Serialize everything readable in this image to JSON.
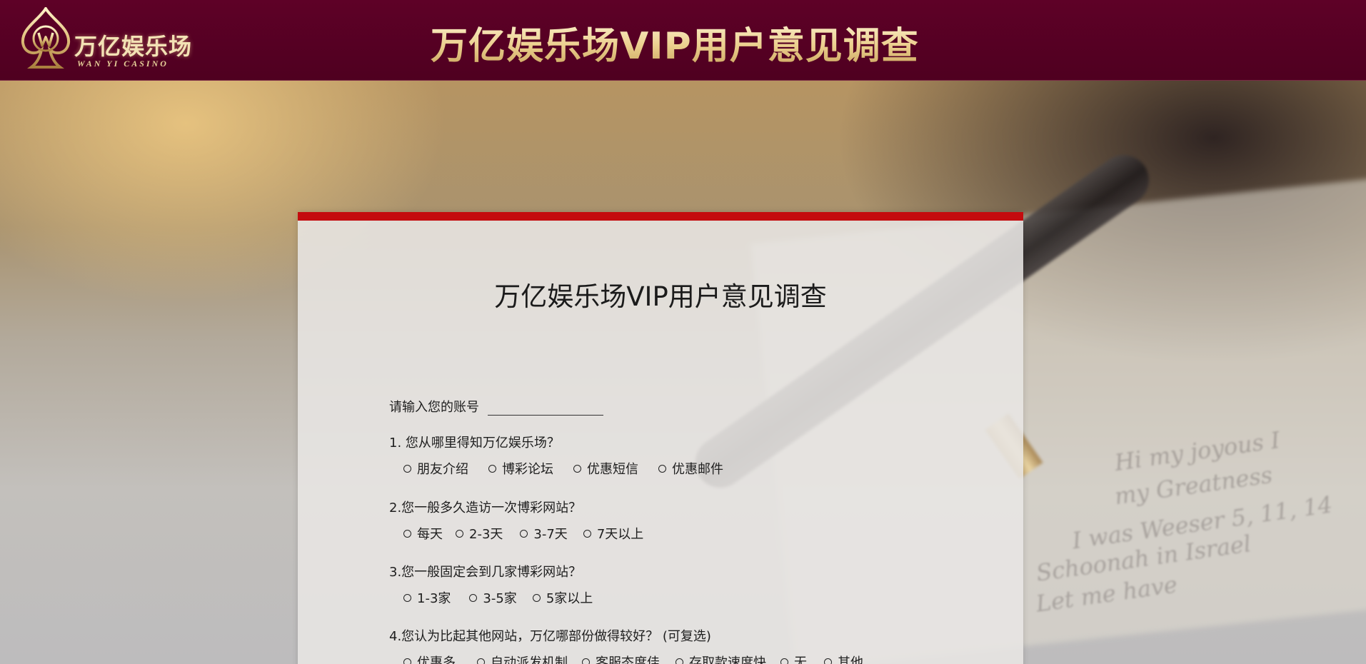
{
  "header": {
    "logo_cn": "万亿娱乐场",
    "logo_en": "WAN YI CASINO",
    "title": "万亿娱乐场VIP用户意见调查"
  },
  "colors": {
    "header_bg": "#5e0127",
    "title_gold": "#f0d89c",
    "card_accent": "#c40b0e"
  },
  "background_script": [
    "Hi my joyous I",
    "my Greatness",
    "I was Weeser 5, 11, 14",
    "Schoonah in Israel",
    "Let me have"
  ],
  "survey": {
    "title": "万亿娱乐场VIP用户意见调查",
    "account_label": "请输入您的账号",
    "account_value": "",
    "questions": [
      {
        "text": "1. 您从哪里得知万亿娱乐场？",
        "options": [
          "朋友介绍",
          "博彩论坛",
          "优惠短信",
          "优惠邮件"
        ]
      },
      {
        "text": "2.您一般多久造访一次博彩网站？",
        "options": [
          "每天",
          "2-3天",
          "3-7天",
          "7天以上"
        ]
      },
      {
        "text": "3.您一般固定会到几家博彩网站？",
        "options": [
          "1-3家",
          "3-5家",
          "5家以上"
        ]
      },
      {
        "text": "4.您认为比起其他网站，万亿哪部份做得较好？ (可复选)",
        "options": [
          "优惠多",
          "自动派发机制",
          "客服态度佳",
          "存取款速度快",
          "无",
          "其他"
        ]
      }
    ]
  }
}
